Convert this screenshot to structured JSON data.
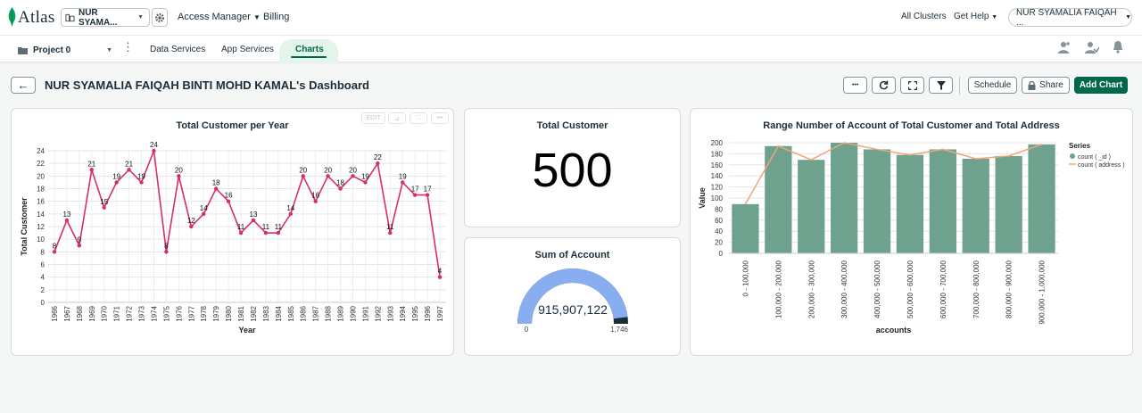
{
  "app": {
    "logo_text": "Atlas",
    "org_name": "NUR SYAMA...",
    "nav": [
      "Access Manager",
      "Billing"
    ],
    "right_nav": [
      "All Clusters",
      "Get Help"
    ],
    "user_name": "NUR SYAMALIA FAIQAH ...",
    "colors": {
      "brand": "#00684a",
      "accent_bg": "#e3f4ea"
    }
  },
  "project": {
    "name": "Project 0",
    "tabs": [
      {
        "label": "Data Services",
        "active": false
      },
      {
        "label": "App Services",
        "active": false
      },
      {
        "label": "Charts",
        "active": true
      }
    ]
  },
  "dashboard": {
    "title": "NUR SYAMALIA FAIQAH BINTI MOHD KAMAL's Dashboard",
    "actions": {
      "more": "•••",
      "schedule": "Schedule",
      "share": "Share",
      "add_chart": "Add Chart"
    }
  },
  "card_controls": {
    "edit": "EDIT",
    "more": "•••"
  },
  "kpi_total": {
    "title": "Total Customer",
    "value": "500"
  },
  "gauge": {
    "title": "Sum of Account",
    "value": "915,907,122",
    "min": "0",
    "max": "1,746",
    "fraction": 0.96
  },
  "chart_data": [
    {
      "type": "line",
      "title": "Total Customer per Year",
      "xlabel": "Year",
      "ylabel": "Total Customer",
      "ylim": [
        0,
        24
      ],
      "yticks": [
        "0",
        "2",
        "4",
        "6",
        "8",
        "10",
        "12",
        "14",
        "16",
        "18",
        "20",
        "22",
        "24"
      ],
      "grid": true,
      "color": "#d82d6d",
      "x": [
        "1966",
        "1967",
        "1968",
        "1969",
        "1970",
        "1971",
        "1972",
        "1973",
        "1974",
        "1975",
        "1976",
        "1977",
        "1978",
        "1979",
        "1980",
        "1981",
        "1982",
        "1983",
        "1984",
        "1985",
        "1986",
        "1987",
        "1988",
        "1989",
        "1990",
        "1991",
        "1992",
        "1993",
        "1994",
        "1995",
        "1996",
        "1997"
      ],
      "values": [
        8,
        13,
        9,
        21,
        15,
        19,
        21,
        19,
        24,
        8,
        20,
        12,
        14,
        18,
        16,
        11,
        13,
        11,
        11,
        14,
        20,
        16,
        20,
        18,
        20,
        19,
        22,
        11,
        19,
        17,
        17,
        4
      ],
      "data_labels": [
        "8",
        "13",
        "9",
        "21",
        "15",
        "19",
        "21",
        "19",
        "24",
        "8",
        "20",
        "12",
        "14",
        "18",
        "16",
        "11",
        "13",
        "11",
        "11",
        "14",
        "20",
        "16",
        "20",
        "18",
        "20",
        "19",
        "22",
        "11",
        "19",
        "17",
        "17",
        "4"
      ]
    },
    {
      "type": "bar",
      "title": "Range Number of Account of Total Customer and Total Address",
      "xlabel": "accounts",
      "ylabel": "Value",
      "ylim": [
        0,
        200
      ],
      "yticks": [
        "0",
        "20",
        "40",
        "60",
        "80",
        "100",
        "120",
        "140",
        "160",
        "180",
        "200"
      ],
      "grid": true,
      "legend_title": "Series",
      "legend_position": "right",
      "categories": [
        "0 - 100,000",
        "100,000 - 200,000",
        "200,000 - 300,000",
        "300,000 - 400,000",
        "400,000 - 500,000",
        "500,000 - 600,000",
        "600,000 - 700,000",
        "700,000 - 800,000",
        "800,000 - 900,000",
        "900,000 - 1,000,000"
      ],
      "series": [
        {
          "name": "count ( _id )",
          "type": "bar",
          "color": "#6fa28e",
          "values": [
            89,
            194,
            169,
            200,
            188,
            178,
            188,
            171,
            176,
            197
          ]
        },
        {
          "name": "count ( address )",
          "type": "line",
          "color": "#f0a479",
          "values": [
            89,
            194,
            169,
            200,
            188,
            178,
            188,
            171,
            176,
            197
          ]
        }
      ]
    }
  ]
}
